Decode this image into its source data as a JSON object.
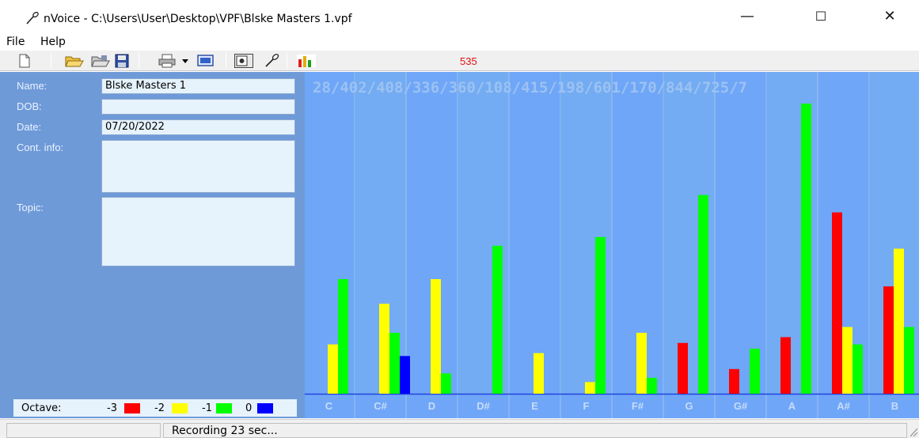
{
  "window": {
    "title": "nVoice - C:\\Users\\User\\Desktop\\VPF\\Blske Masters 1.vpf",
    "icon": "microphone-icon",
    "minimize_glyph": "—",
    "maximize_glyph": "☐",
    "close_glyph": "✕"
  },
  "menu": {
    "file": "File",
    "help": "Help"
  },
  "toolbar": {
    "buttons": [
      "new-file-icon",
      "open-folder-icon",
      "open-recent-icon",
      "save-icon",
      "print-icon",
      "print-dropdown-icon",
      "monitor-icon",
      "sound-card-icon",
      "microphone-icon",
      "bar-chart-icon"
    ],
    "counter": "535"
  },
  "form": {
    "name_label": "Name:",
    "name_value": "Blske Masters 1",
    "dob_label": "DOB:",
    "dob_value": "",
    "date_label": "Date:",
    "date_value": "07/20/2022",
    "contact_label": "Cont. info:",
    "contact_value": "",
    "topic_label": "Topic:",
    "topic_value": ""
  },
  "octave_legend": {
    "label": "Octave:",
    "items": [
      {
        "value": "-3",
        "color": "#ff0000"
      },
      {
        "value": "-2",
        "color": "#ffff00"
      },
      {
        "value": "-1",
        "color": "#00ff00"
      },
      {
        "value": "0",
        "color": "#0000ff"
      }
    ]
  },
  "status": {
    "text": "Recording 23 sec..."
  },
  "chart_data": {
    "type": "bar",
    "top_text": "28/402/408/336/360/108/415/198/601/170/844/725/7",
    "categories": [
      "C",
      "C#",
      "D",
      "D#",
      "E",
      "F",
      "F#",
      "G",
      "G#",
      "A",
      "A#",
      "B"
    ],
    "ylim": [
      0,
      100
    ],
    "colors": {
      "background": "#6fa6f8",
      "stripe": "#77b0ec",
      "gridline": "#9cc4f0",
      "top_text": "#9cc2f2",
      "label_text": "#c8dcf8"
    },
    "series": [
      {
        "name": "-3",
        "color": "#ff0000",
        "values": [
          0,
          0,
          0,
          0,
          0,
          0,
          0,
          17.5,
          8.5,
          19.5,
          62.5,
          37
        ]
      },
      {
        "name": "-2",
        "color": "#ffff00",
        "values": [
          17,
          31,
          39.5,
          0,
          14,
          4,
          21,
          0,
          0,
          0,
          23,
          50
        ]
      },
      {
        "name": "-1",
        "color": "#00ff00",
        "values": [
          39.5,
          21,
          7,
          51,
          0,
          54,
          5.5,
          68.5,
          15.5,
          100,
          17,
          23
        ]
      },
      {
        "name": "0",
        "color": "#0000ff",
        "values": [
          0,
          13,
          0,
          0,
          0,
          0,
          0,
          0,
          0,
          0,
          0,
          0
        ]
      }
    ]
  }
}
